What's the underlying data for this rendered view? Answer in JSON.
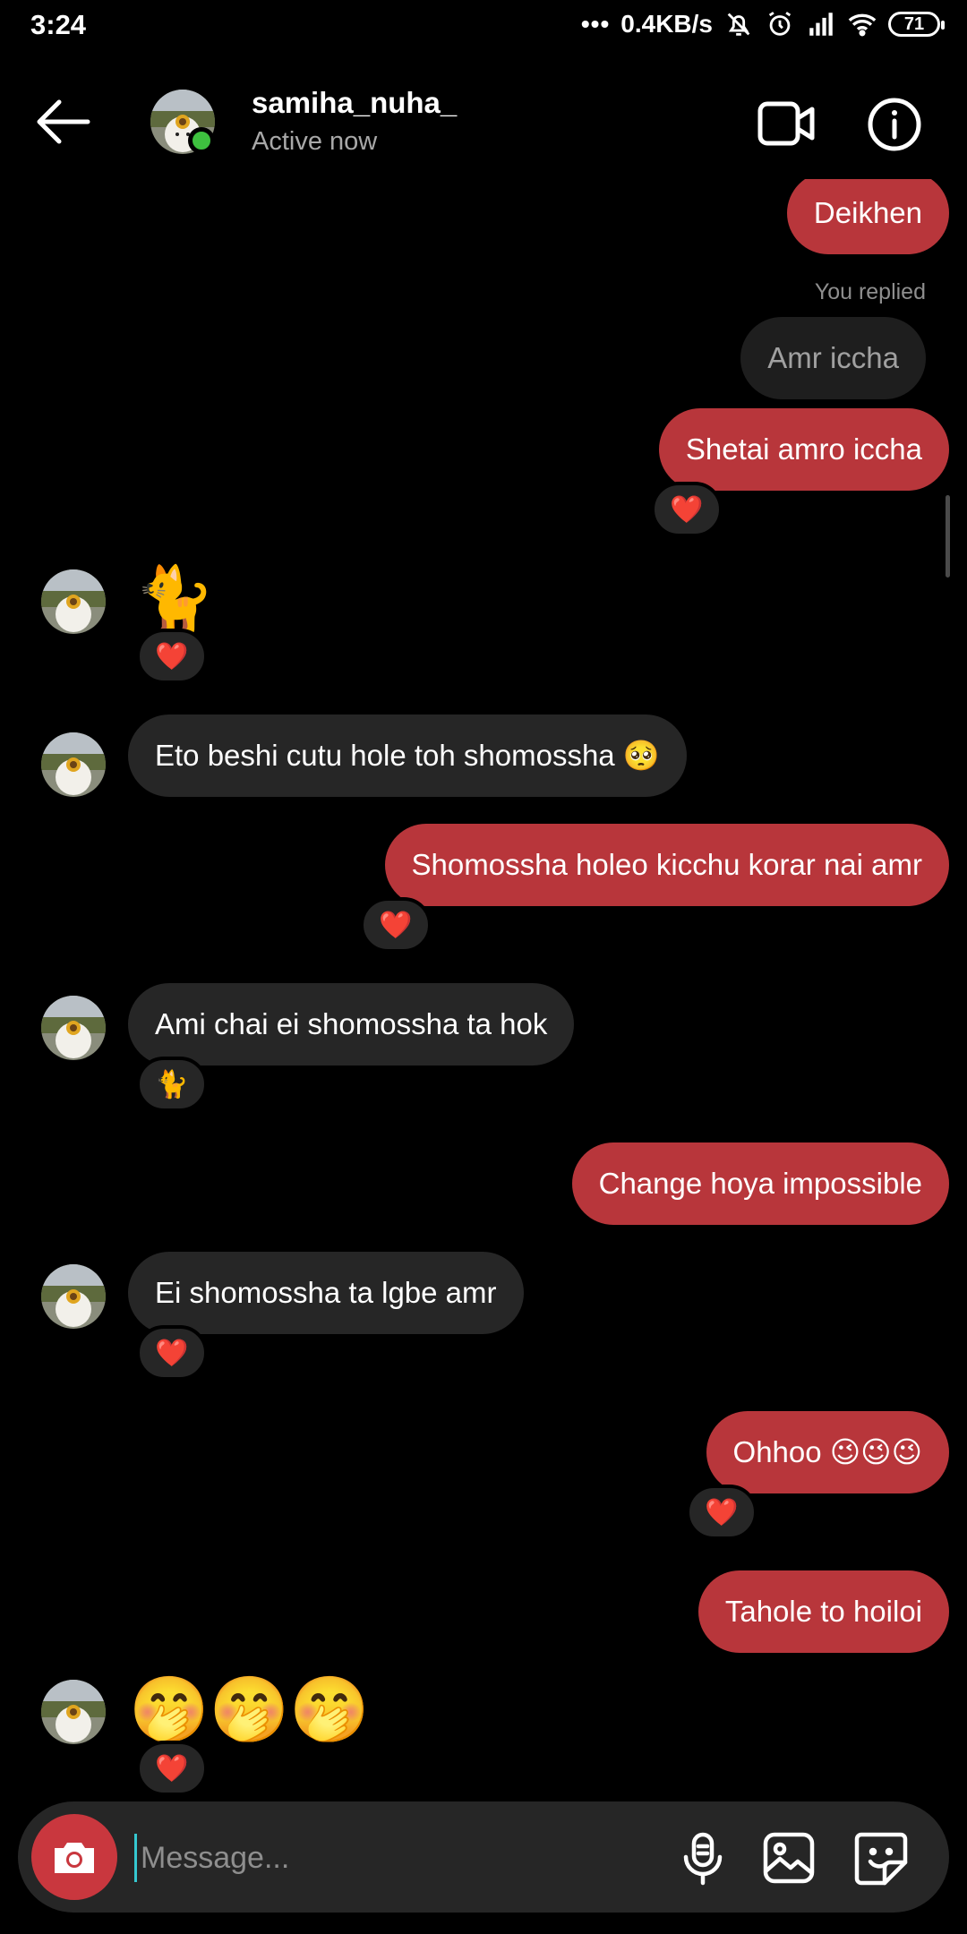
{
  "status_bar": {
    "time": "3:24",
    "speed": "0.4KB/s",
    "dots": "•••",
    "battery": "71"
  },
  "header": {
    "username": "samiha_nuha_",
    "status": "Active now"
  },
  "messages": {
    "m1": "Deikhen",
    "replied_label": "You replied",
    "m2_reply": "Amr iccha",
    "m3": "Shetai amro iccha",
    "m3_react": "❤️",
    "m4_emoji": "🐈",
    "m4_react": "❤️",
    "m5": "Eto beshi cutu hole toh shomossha 🥺",
    "m6": "Shomossha holeo kicchu korar nai amr",
    "m6_react": "❤️",
    "m7": "Ami chai ei shomossha ta hok",
    "m7_react": "🐈",
    "m8": "Change hoya impossible",
    "m9": "Ei shomossha ta lgbe amr",
    "m9_react": "❤️",
    "m10": "Ohhoo 😉😉😉",
    "m10_react": "❤️",
    "m11": "Tahole to hoiloi",
    "m12_emoji": "🤭🤭🤭",
    "m12_react": "❤️"
  },
  "composer": {
    "placeholder": "Message..."
  },
  "colors": {
    "outgoing_bubble": "#b8363b",
    "incoming_bubble": "#262626",
    "online": "#3ec13f",
    "camera_button": "#c9373e"
  },
  "icons": [
    "back-arrow-icon",
    "video-call-icon",
    "info-icon",
    "camera-icon",
    "microphone-icon",
    "gallery-icon",
    "sticker-icon",
    "alarm-icon",
    "mute-icon",
    "signal-icon",
    "wifi-icon",
    "heart-icon"
  ]
}
